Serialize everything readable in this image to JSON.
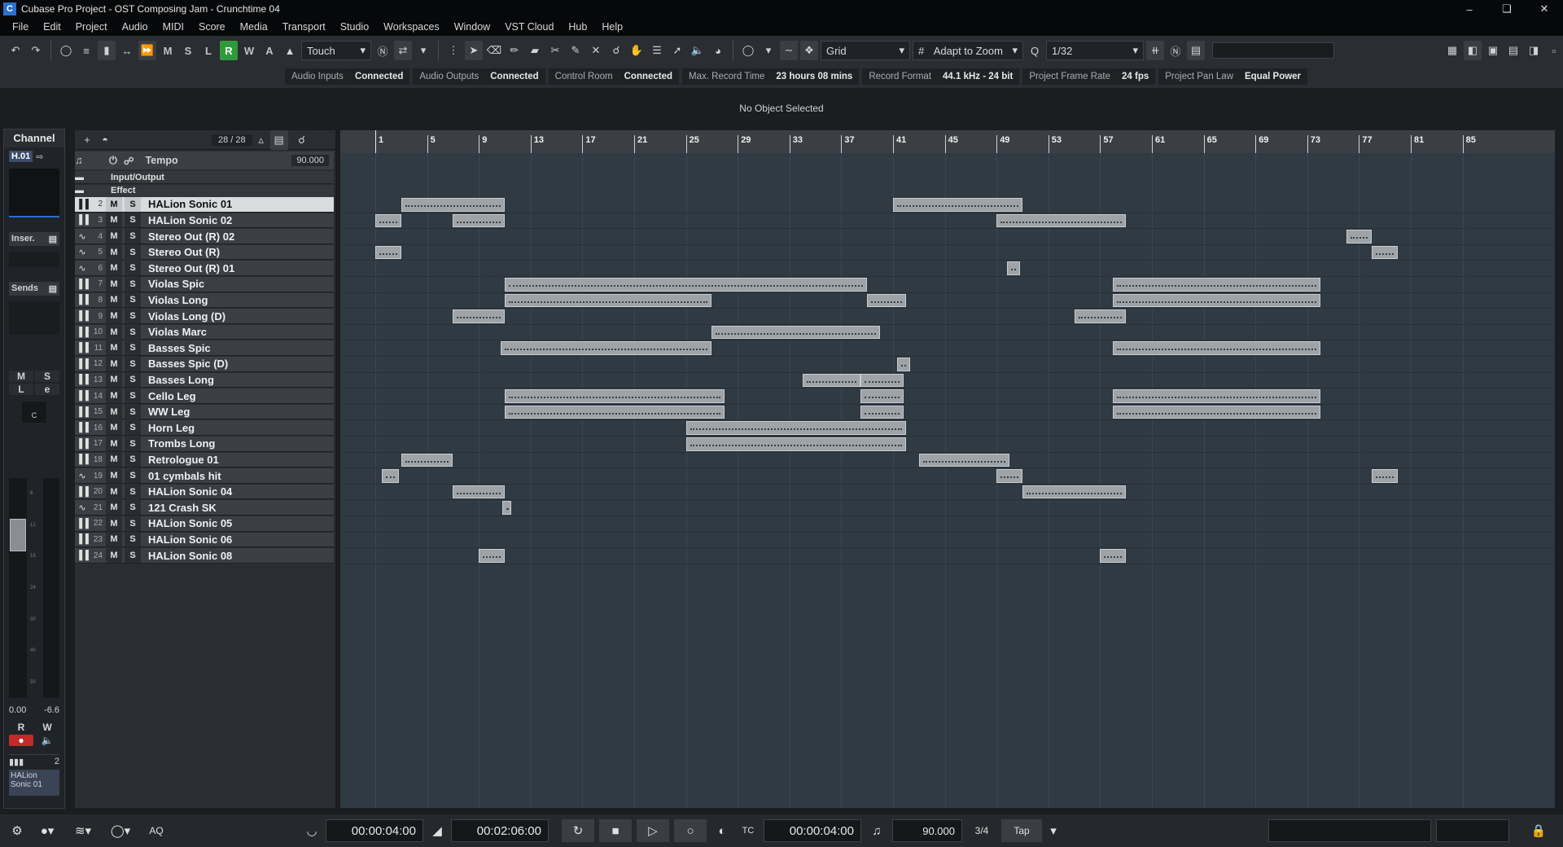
{
  "window": {
    "title": "Cubase Pro Project - OST Composing Jam - Crunchtime 04"
  },
  "menu": [
    "File",
    "Edit",
    "Project",
    "Audio",
    "MIDI",
    "Score",
    "Media",
    "Transport",
    "Studio",
    "Workspaces",
    "Window",
    "VST Cloud",
    "Hub",
    "Help"
  ],
  "toolbar": {
    "automation_mode": "Touch",
    "snap_type": "Grid",
    "grid": "Adapt to Zoom",
    "quantize": "1/32",
    "mode_buttons": [
      "M",
      "S",
      "L",
      "R",
      "W",
      "A"
    ]
  },
  "status": [
    {
      "k": "Audio Inputs",
      "v": "Connected"
    },
    {
      "k": "Audio Outputs",
      "v": "Connected"
    },
    {
      "k": "Control Room",
      "v": "Connected"
    },
    {
      "k": "Max. Record Time",
      "v": "23 hours 08 mins"
    },
    {
      "k": "Record Format",
      "v": "44.1 kHz - 24 bit"
    },
    {
      "k": "Project Frame Rate",
      "v": "24 fps"
    },
    {
      "k": "Project Pan Law",
      "v": "Equal Power"
    }
  ],
  "info_line": "No Object Selected",
  "inspector": {
    "title": "Channel",
    "track_id": "H.01",
    "inserts": "Inser.",
    "sends": "Sends",
    "m": "M",
    "s": "S",
    "l": "L",
    "e": "e",
    "pan": "C",
    "vol": "0.00",
    "peak": "-6.6",
    "r": "R",
    "w": "W",
    "channel_num": "2",
    "channel_name": "HALion Sonic 01",
    "meter_scale": [
      "6",
      "12",
      "18",
      "24",
      "30",
      "40",
      "50"
    ]
  },
  "track_count": "28 / 28",
  "tempo_track": {
    "label": "Tempo",
    "value": "90.000"
  },
  "folders": [
    "Input/Output",
    "Effect"
  ],
  "tracks": [
    {
      "n": "2",
      "name": "HALion Sonic 01",
      "type": "inst"
    },
    {
      "n": "3",
      "name": "HALion Sonic 02",
      "type": "inst"
    },
    {
      "n": "4",
      "name": "Stereo Out (R) 02",
      "type": "audio"
    },
    {
      "n": "5",
      "name": "Stereo Out (R)",
      "type": "audio"
    },
    {
      "n": "6",
      "name": "Stereo Out (R) 01",
      "type": "audio"
    },
    {
      "n": "7",
      "name": "Violas Spic",
      "type": "inst"
    },
    {
      "n": "8",
      "name": "Violas Long",
      "type": "inst"
    },
    {
      "n": "9",
      "name": "Violas Long (D)",
      "type": "inst"
    },
    {
      "n": "10",
      "name": "Violas Marc",
      "type": "inst"
    },
    {
      "n": "11",
      "name": "Basses Spic",
      "type": "inst"
    },
    {
      "n": "12",
      "name": "Basses Spic (D)",
      "type": "inst"
    },
    {
      "n": "13",
      "name": "Basses Long",
      "type": "inst"
    },
    {
      "n": "14",
      "name": "Cello Leg",
      "type": "inst"
    },
    {
      "n": "15",
      "name": "WW Leg",
      "type": "inst"
    },
    {
      "n": "16",
      "name": "Horn Leg",
      "type": "inst"
    },
    {
      "n": "17",
      "name": "Trombs Long",
      "type": "inst"
    },
    {
      "n": "18",
      "name": "Retrologue 01",
      "type": "inst"
    },
    {
      "n": "19",
      "name": "01 cymbals hit",
      "type": "audio"
    },
    {
      "n": "20",
      "name": "HALion Sonic 04",
      "type": "inst"
    },
    {
      "n": "21",
      "name": "121 Crash SK",
      "type": "audio"
    },
    {
      "n": "22",
      "name": "HALion Sonic 05",
      "type": "inst"
    },
    {
      "n": "23",
      "name": "HALion Sonic 06",
      "type": "inst"
    },
    {
      "n": "24",
      "name": "HALion Sonic 08",
      "type": "inst"
    }
  ],
  "ruler": [
    "1",
    "5",
    "9",
    "13",
    "17",
    "21",
    "25",
    "29",
    "33",
    "37",
    "41",
    "45",
    "49",
    "53",
    "57",
    "61",
    "65",
    "69",
    "73",
    "77",
    "81",
    "85"
  ],
  "parts": [
    {
      "row": 0,
      "bar": 3,
      "len": 8
    },
    {
      "row": 0,
      "bar": 41,
      "len": 10
    },
    {
      "row": 1,
      "bar": 1,
      "len": 2
    },
    {
      "row": 1,
      "bar": 7,
      "len": 4
    },
    {
      "row": 1,
      "bar": 49,
      "len": 10
    },
    {
      "row": 2,
      "bar": 76,
      "len": 2
    },
    {
      "row": 3,
      "bar": 1,
      "len": 2
    },
    {
      "row": 3,
      "bar": 78,
      "len": 2
    },
    {
      "row": 4,
      "bar": 49.8,
      "len": 1
    },
    {
      "row": 5,
      "bar": 11,
      "len": 28
    },
    {
      "row": 5,
      "bar": 58,
      "len": 16
    },
    {
      "row": 6,
      "bar": 11,
      "len": 16
    },
    {
      "row": 6,
      "bar": 39,
      "len": 3
    },
    {
      "row": 6,
      "bar": 58,
      "len": 16
    },
    {
      "row": 7,
      "bar": 7,
      "len": 4
    },
    {
      "row": 7,
      "bar": 55,
      "len": 4
    },
    {
      "row": 8,
      "bar": 27,
      "len": 13
    },
    {
      "row": 9,
      "bar": 10.7,
      "len": 16.3
    },
    {
      "row": 9,
      "bar": 58,
      "len": 16
    },
    {
      "row": 10,
      "bar": 41.3,
      "len": 1
    },
    {
      "row": 11,
      "bar": 34,
      "len": 4.5
    },
    {
      "row": 11,
      "bar": 38.5,
      "len": 3.3
    },
    {
      "row": 12,
      "bar": 11,
      "len": 17
    },
    {
      "row": 12,
      "bar": 38.5,
      "len": 3.3
    },
    {
      "row": 12,
      "bar": 58,
      "len": 16
    },
    {
      "row": 13,
      "bar": 11,
      "len": 17
    },
    {
      "row": 13,
      "bar": 38.5,
      "len": 3.3
    },
    {
      "row": 13,
      "bar": 58,
      "len": 16
    },
    {
      "row": 14,
      "bar": 25,
      "len": 17
    },
    {
      "row": 15,
      "bar": 25,
      "len": 17
    },
    {
      "row": 16,
      "bar": 3,
      "len": 4
    },
    {
      "row": 16,
      "bar": 43,
      "len": 7
    },
    {
      "row": 17,
      "bar": 1.5,
      "len": 1.3
    },
    {
      "row": 17,
      "bar": 49,
      "len": 2
    },
    {
      "row": 17,
      "bar": 78,
      "len": 2
    },
    {
      "row": 18,
      "bar": 7,
      "len": 4
    },
    {
      "row": 18,
      "bar": 51,
      "len": 8
    },
    {
      "row": 19,
      "bar": 10.8,
      "len": 0.7
    },
    {
      "row": 22,
      "bar": 9,
      "len": 2
    },
    {
      "row": 22,
      "bar": 57,
      "len": 2
    }
  ],
  "transport": {
    "left_locator": "00:00:04:00",
    "right_locator": "00:02:06:00",
    "position": "00:00:04:00",
    "tempo": "90.000",
    "signature": "3/4",
    "tap": "Tap",
    "aq": "AQ"
  }
}
